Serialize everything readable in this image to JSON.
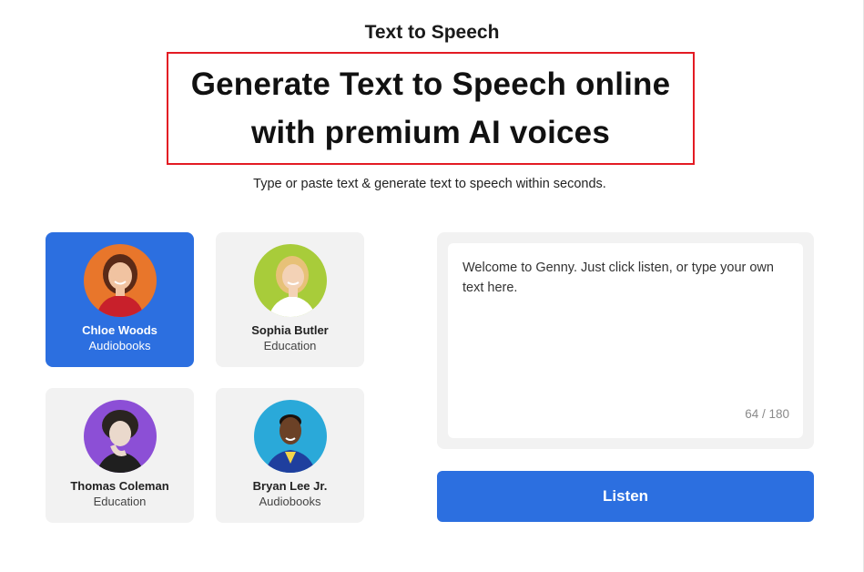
{
  "header": {
    "eyebrow": "Text to Speech",
    "headline_line1": "Generate Text to Speech online",
    "headline_line2": "with premium AI voices",
    "subtitle": "Type or paste text & generate text to speech within seconds."
  },
  "voices": [
    {
      "name": "Chloe Woods",
      "category": "Audiobooks",
      "selected": true,
      "avatar_bg": "#e8762b"
    },
    {
      "name": "Sophia Butler",
      "category": "Education",
      "selected": false,
      "avatar_bg": "#a8cc3a"
    },
    {
      "name": "Thomas Coleman",
      "category": "Education",
      "selected": false,
      "avatar_bg": "#8c4fd6"
    },
    {
      "name": "Bryan Lee Jr.",
      "category": "Audiobooks",
      "selected": false,
      "avatar_bg": "#2aa9d9"
    }
  ],
  "editor": {
    "value": "Welcome to Genny. Just click listen, or type your own text here.",
    "char_count": "64 / 180"
  },
  "listen_label": "Listen",
  "colors": {
    "accent": "#2c6fe0",
    "highlight_border": "#e31b23",
    "card_bg": "#f2f2f2"
  }
}
